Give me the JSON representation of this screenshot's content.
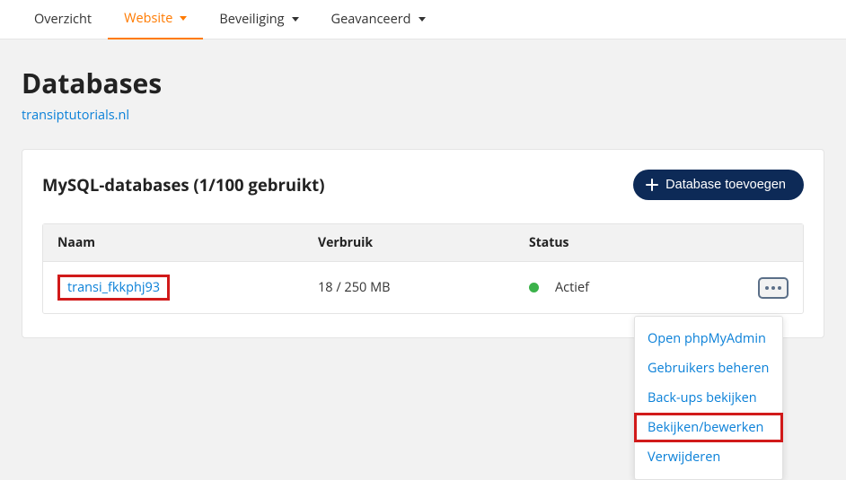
{
  "nav": {
    "tabs": [
      {
        "label": "Overzicht",
        "hasCaret": false,
        "active": false
      },
      {
        "label": "Website",
        "hasCaret": true,
        "active": true
      },
      {
        "label": "Beveiliging",
        "hasCaret": true,
        "active": false
      },
      {
        "label": "Geavanceerd",
        "hasCaret": true,
        "active": false
      }
    ]
  },
  "page": {
    "title": "Databases",
    "breadcrumb": "transiptutorials.nl"
  },
  "panel": {
    "title": "MySQL-databases (1/100 gebruikt)",
    "addButton": "Database toevoegen"
  },
  "table": {
    "headers": {
      "name": "Naam",
      "usage": "Verbruik",
      "status": "Status"
    },
    "rows": [
      {
        "name": "transi_fkkphj93",
        "usage": "18 / 250 MB",
        "status": "Actief",
        "statusColor": "#3bb24a"
      }
    ]
  },
  "menu": {
    "items": [
      {
        "label": "Open phpMyAdmin"
      },
      {
        "label": "Gebruikers beheren"
      },
      {
        "label": "Back-ups bekijken"
      },
      {
        "label": "Bekijken/bewerken",
        "highlight": true
      },
      {
        "label": "Verwijderen"
      }
    ]
  }
}
